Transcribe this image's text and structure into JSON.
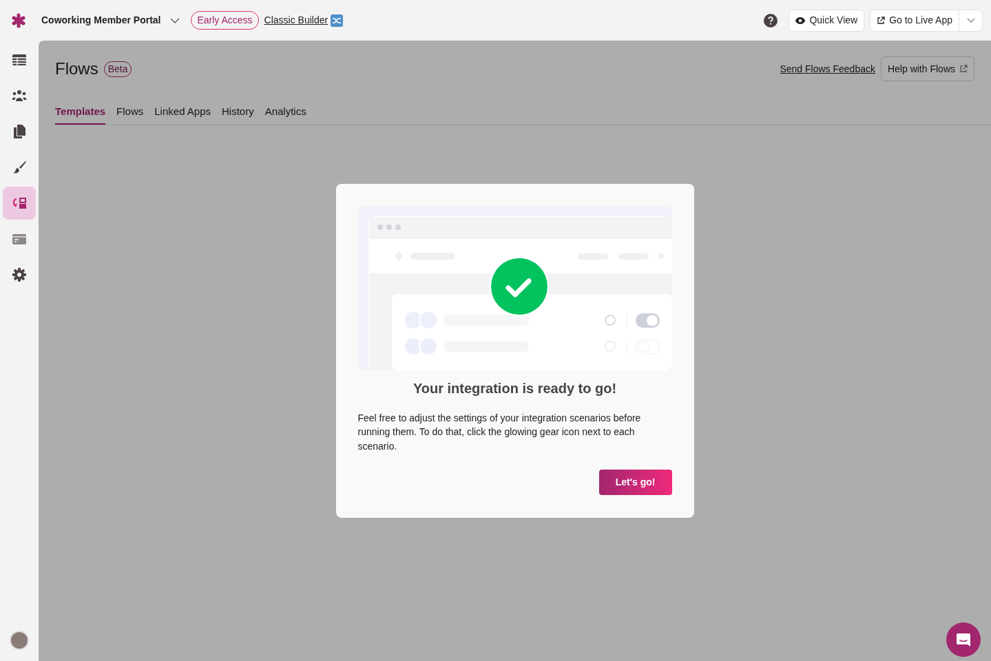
{
  "app": {
    "title": "Coworking Member Portal"
  },
  "top_bar": {
    "early_access": "Early Access",
    "classic_builder": "Classic Builder",
    "quick_view": "Quick View",
    "live_app": "Go to Live App"
  },
  "sidebar": {
    "items": [
      {
        "selected": false
      },
      {
        "selected": false
      },
      {
        "selected": false
      },
      {
        "selected": false
      },
      {
        "selected": true
      },
      {
        "selected": false
      },
      {
        "selected": false
      }
    ]
  },
  "page": {
    "title": "Flows",
    "badge": "Beta",
    "feedback_link": "Send Flows Feedback",
    "help_button": "Help with Flows"
  },
  "tabs": [
    {
      "label": "Templates",
      "selected": true
    },
    {
      "label": "Flows",
      "selected": false
    },
    {
      "label": "Linked Apps",
      "selected": false
    },
    {
      "label": "History",
      "selected": false
    },
    {
      "label": "Analytics",
      "selected": false
    }
  ],
  "modal": {
    "title": "Your integration is ready to go!",
    "body": "Feel free to adjust the settings of your integration scenarios before running them. To do that, click the glowing gear icon next to each scenario.",
    "button": "Let's go!"
  }
}
